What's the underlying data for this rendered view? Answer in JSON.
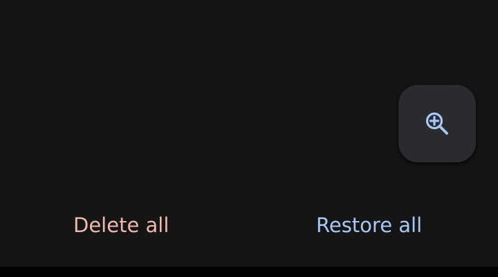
{
  "screen": {
    "background": "#151515"
  },
  "zoom_button": {
    "icon": "zoom-in-icon",
    "icon_color": "#a8c7fa",
    "background": "#2a2b2e"
  },
  "actions": {
    "delete_all_label": "Delete all",
    "delete_all_color": "#f0b8ae",
    "restore_all_label": "Restore all",
    "restore_all_color": "#a8c7fa"
  }
}
